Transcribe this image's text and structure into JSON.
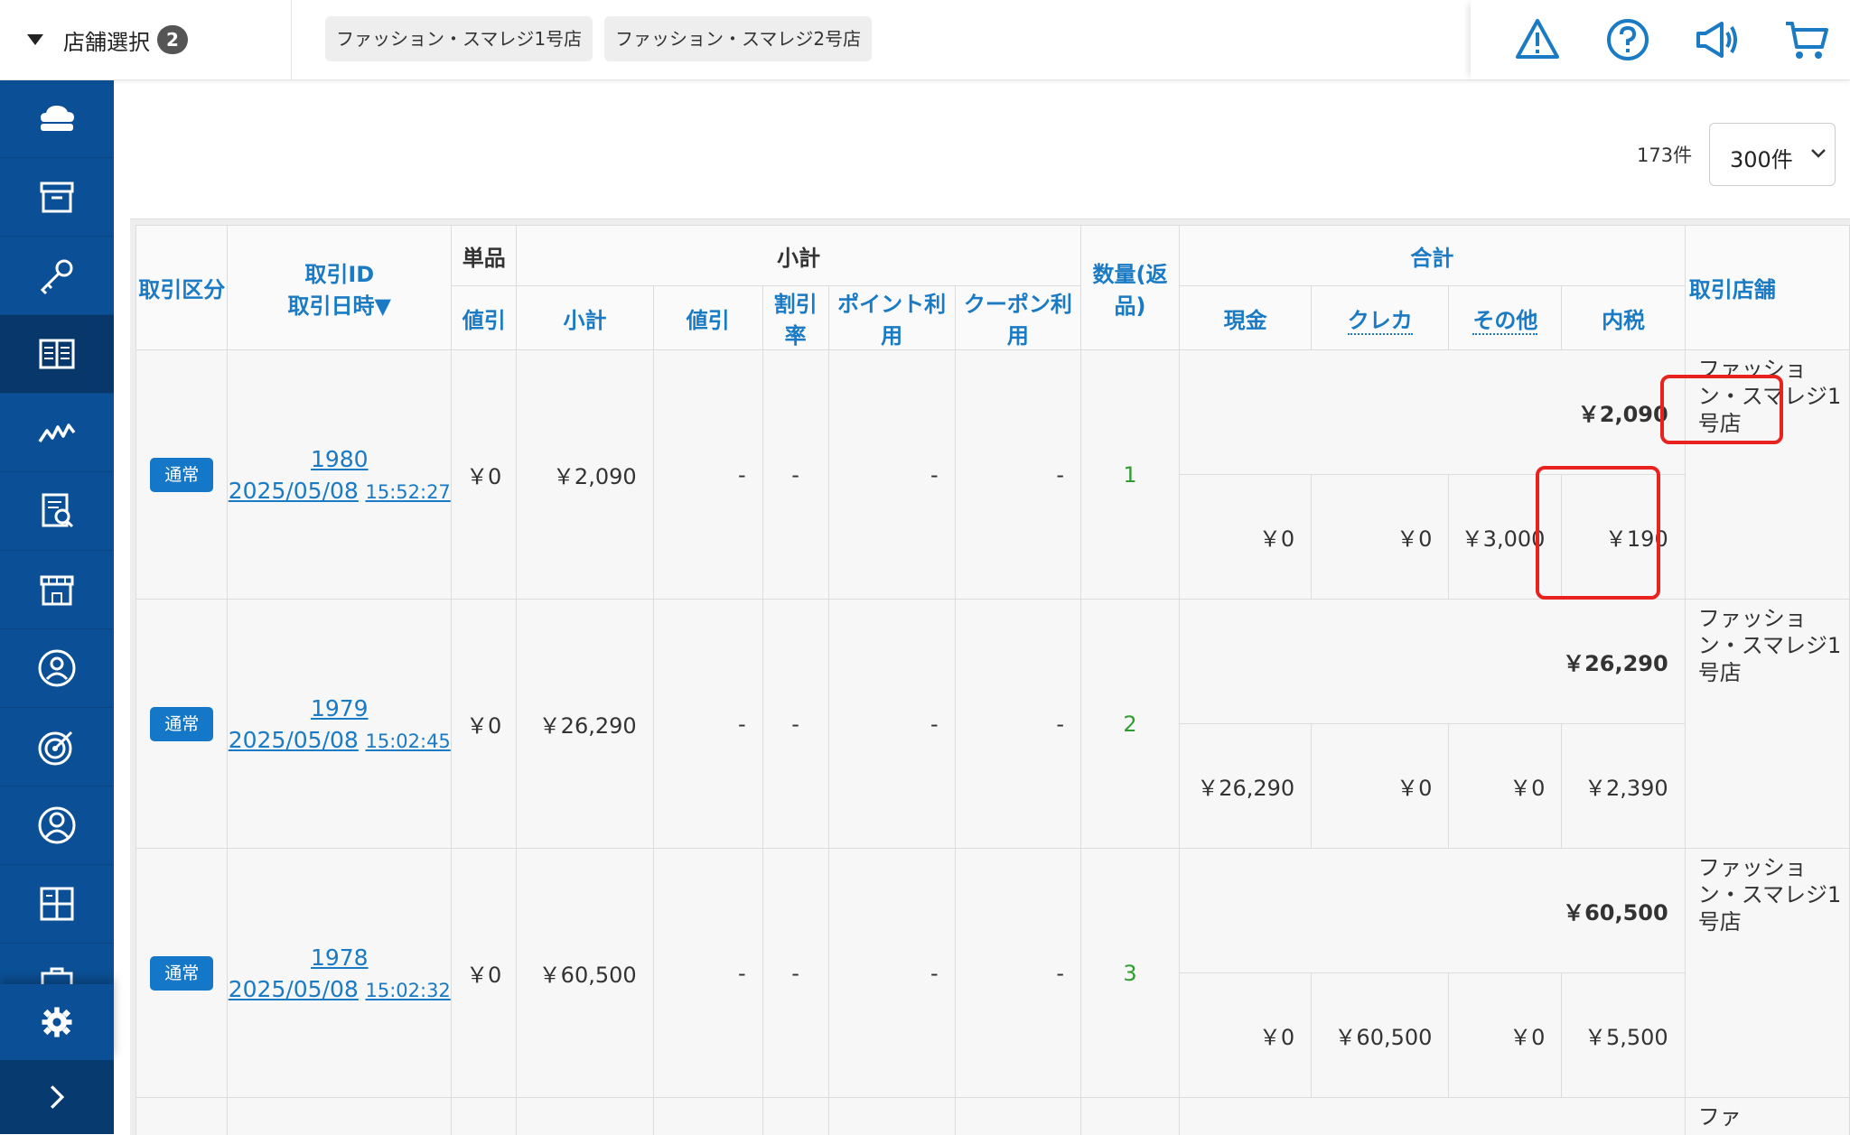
{
  "header": {
    "store_select_label": "店舗選択",
    "store_select_count": "2",
    "chips": [
      "ファッション・スマレジ1号店",
      "ファッション・スマレジ2号店"
    ],
    "icons": [
      "warning-icon",
      "help-icon",
      "megaphone-icon",
      "cart-icon"
    ]
  },
  "sidebar": {
    "items": [
      "cloud-register-icon",
      "archive-box-icon",
      "key-icon",
      "book-icon",
      "chart-icon",
      "report-icon",
      "store-icon",
      "customer-icon",
      "target-icon",
      "member-icon",
      "grid-icon",
      "bag-icon"
    ],
    "active_index": 3,
    "settings_icon": "gear-icon",
    "expand_icon": "chevron-right-icon"
  },
  "list": {
    "count_label": "173件",
    "per_page": "300件"
  },
  "table": {
    "headers": {
      "type": "取引区分",
      "id": "取引ID",
      "datetime": "取引日時▼",
      "item_group": "単品",
      "subtotal_group": "小計",
      "qty": "数量(返品)",
      "total_group": "合計",
      "store": "取引店舗",
      "item_discount": "値引",
      "subtotal": "小計",
      "sub_discount": "値引",
      "discount_rate": "割引率",
      "point_use": "ポイント利用",
      "coupon_use": "クーポン利用",
      "cash": "現金",
      "credit": "クレカ",
      "other": "その他",
      "tax": "内税"
    },
    "rows": [
      {
        "type": "通常",
        "id": "1980",
        "date": "2025/05/08",
        "time": "15:52:27",
        "item_discount": "￥0",
        "subtotal": "￥2,090",
        "sub_discount": "-",
        "discount_rate": "-",
        "point_use": "-",
        "coupon_use": "-",
        "qty": "1",
        "total": "￥2,090",
        "cash": "￥0",
        "credit": "￥0",
        "other": "￥3,000",
        "tax": "￥190",
        "store": "ファッション・スマレジ1号店"
      },
      {
        "type": "通常",
        "id": "1979",
        "date": "2025/05/08",
        "time": "15:02:45",
        "item_discount": "￥0",
        "subtotal": "￥26,290",
        "sub_discount": "-",
        "discount_rate": "-",
        "point_use": "-",
        "coupon_use": "-",
        "qty": "2",
        "total": "￥26,290",
        "cash": "￥26,290",
        "credit": "￥0",
        "other": "￥0",
        "tax": "￥2,390",
        "store": "ファッション・スマレジ1号店"
      },
      {
        "type": "通常",
        "id": "1978",
        "date": "2025/05/08",
        "time": "15:02:32",
        "item_discount": "￥0",
        "subtotal": "￥60,500",
        "sub_discount": "-",
        "discount_rate": "-",
        "point_use": "-",
        "coupon_use": "-",
        "qty": "3",
        "total": "￥60,500",
        "cash": "￥0",
        "credit": "￥60,500",
        "other": "￥0",
        "tax": "￥5,500",
        "store": "ファッション・スマレジ1号店"
      }
    ],
    "partial_row_store": "ファ"
  },
  "colors": {
    "sidebar": "#0b5096",
    "accent": "#1a7ac4",
    "highlight": "#e8231f",
    "tag": "#1577c8"
  }
}
